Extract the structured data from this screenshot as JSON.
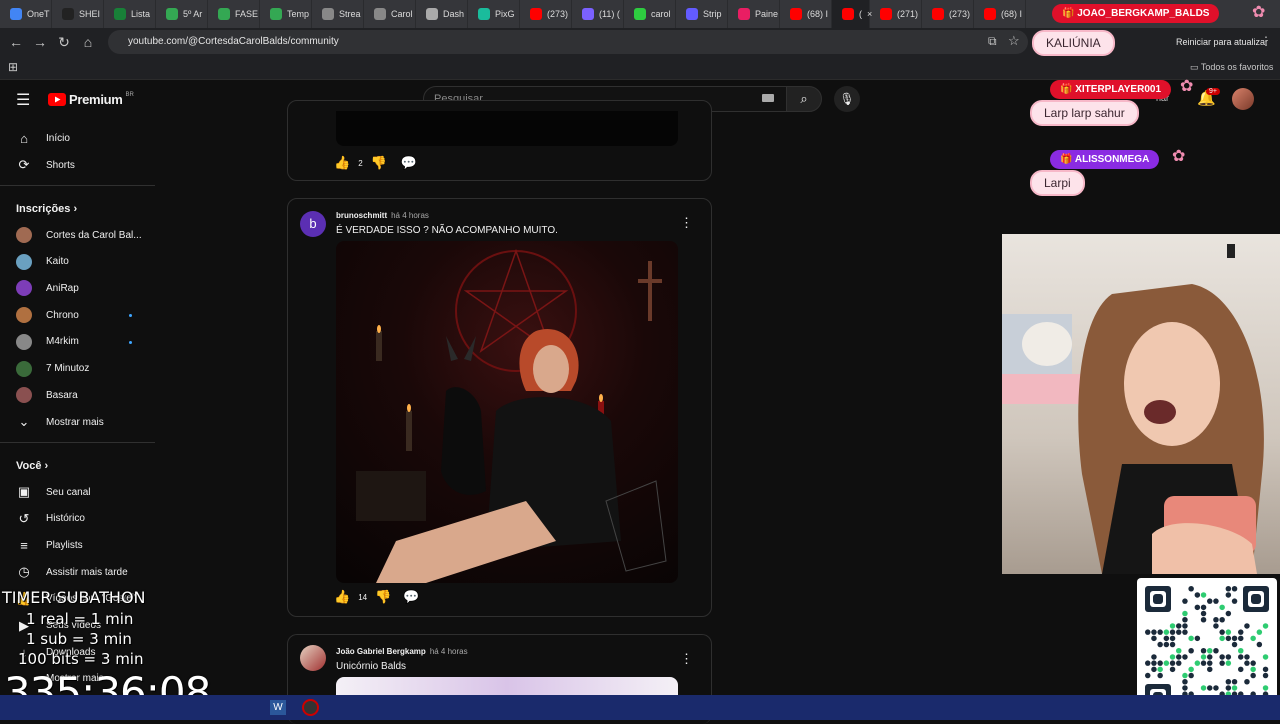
{
  "browser": {
    "tabs": [
      {
        "label": "OneT",
        "color": "#4285f4"
      },
      {
        "label": "SHEI",
        "color": "#222222"
      },
      {
        "label": "Lista",
        "color": "#188038"
      },
      {
        "label": "5º Ar",
        "color": "#34a853"
      },
      {
        "label": "FASE",
        "color": "#34a853"
      },
      {
        "label": "Temp",
        "color": "#34a853"
      },
      {
        "label": "Strea",
        "color": "#888888"
      },
      {
        "label": "Carol",
        "color": "#888888"
      },
      {
        "label": "Dash",
        "color": "#aaaaaa"
      },
      {
        "label": "PixG",
        "color": "#1abc9c"
      },
      {
        "label": "(273)",
        "color": "#ff0000"
      },
      {
        "label": "(11) (",
        "color": "#7b61ff"
      },
      {
        "label": "carol",
        "color": "#2ecc40"
      },
      {
        "label": "Strip",
        "color": "#635bff"
      },
      {
        "label": "Paine",
        "color": "#e91e63"
      },
      {
        "label": "(68) I",
        "color": "#ff0000"
      },
      {
        "label": "(",
        "color": "#ff0000"
      },
      {
        "label": "(271)",
        "color": "#ff0000"
      },
      {
        "label": "(273)",
        "color": "#ff0000"
      },
      {
        "label": "(68) I",
        "color": "#ff0000"
      }
    ],
    "url": "youtube.com/@CortesdaCarolBalds/community",
    "restart_label": "Reiniciar para atualizar",
    "bookmarks_label": "Todos os favoritos"
  },
  "youtube": {
    "logo": "Premium",
    "region": "BR",
    "search_placeholder": "Pesquisar",
    "notif_count": "9+",
    "partial_text": "har"
  },
  "sidebar": {
    "main": [
      {
        "label": "Início",
        "icon": "home-icon",
        "glyph": "⌂"
      },
      {
        "label": "Shorts",
        "icon": "shorts-icon",
        "glyph": "⟳"
      }
    ],
    "subscriptions_title": "Inscrições",
    "subscriptions": [
      {
        "label": "Cortes da Carol Bal...",
        "color": "#a06a52",
        "dot": false
      },
      {
        "label": "Kaito",
        "color": "#6aa0c0",
        "dot": false
      },
      {
        "label": "AniRap",
        "color": "#7d3db8",
        "dot": false
      },
      {
        "label": "Chrono",
        "color": "#b07040",
        "dot": true
      },
      {
        "label": "M4rkim",
        "color": "#888888",
        "dot": true
      },
      {
        "label": "7 Minutoz",
        "color": "#3a6a3a",
        "dot": false
      },
      {
        "label": "Basara",
        "color": "#8a5050",
        "dot": false
      }
    ],
    "show_more": "Mostrar mais",
    "you_title": "Você",
    "you": [
      {
        "label": "Seu canal",
        "icon": "channel-icon",
        "glyph": "▣"
      },
      {
        "label": "Histórico",
        "icon": "history-icon",
        "glyph": "↺"
      },
      {
        "label": "Playlists",
        "icon": "playlists-icon",
        "glyph": "≡"
      },
      {
        "label": "Assistir mais tarde",
        "icon": "watch-later-icon",
        "glyph": "◷"
      },
      {
        "label": "Vídeos com \"Gostei\"",
        "icon": "liked-icon",
        "glyph": "👍"
      },
      {
        "label": "Seus vídeos",
        "icon": "your-videos-icon",
        "glyph": "▶"
      },
      {
        "label": "Downloads",
        "icon": "downloads-icon",
        "glyph": "↓"
      },
      {
        "label": "Mostrar mais",
        "icon": "show-more-icon",
        "glyph": "⌄"
      }
    ]
  },
  "posts": [
    {
      "likes": "2"
    },
    {
      "author": "brunoschmitt",
      "avatar_letter": "b",
      "avatar_color": "#5b2fb3",
      "time": "há 4 horas",
      "text": "É VERDADE ISSO ? NÃO ACOMPANHO MUITO.",
      "likes": "14"
    },
    {
      "author": "João Gabriel Bergkamp",
      "time": "há 4 horas",
      "text": "Unicórnio Balds"
    }
  ],
  "chat": [
    {
      "name": "JOAO_BERGKAMP_BALDS",
      "message": "KALIÚNIA",
      "name_color": "#e0102a"
    },
    {
      "name": "XITERPLAYER001",
      "message": "Larp larp sahur",
      "name_color": "#e0102a"
    },
    {
      "name": "ALISSONMEGA",
      "message": "Larpi",
      "name_color": "#8a2be2"
    }
  ],
  "timer": {
    "title": "TIMER SUBATHON",
    "rules": [
      "1 real = 1 min",
      "1 sub = 3 min",
      "100 bits = 3 min"
    ],
    "clock": "335:36:08"
  }
}
